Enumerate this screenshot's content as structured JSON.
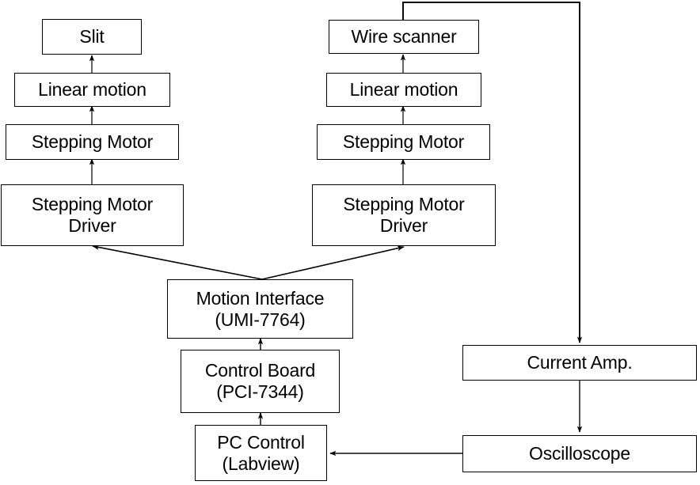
{
  "diagram": {
    "title": "Beam profile measurement control block diagram",
    "background_color": "#ffffff",
    "line_color": "#000000",
    "text_color": "#000000",
    "nodes": {
      "slit": {
        "label": "Slit"
      },
      "left_linear_motion": {
        "label": "Linear motion"
      },
      "left_stepping_motor": {
        "label": "Stepping Motor"
      },
      "left_stepping_motor_driver": {
        "label": "Stepping Motor\nDriver"
      },
      "wire_scanner": {
        "label": "Wire scanner"
      },
      "right_linear_motion": {
        "label": "Linear motion"
      },
      "right_stepping_motor": {
        "label": "Stepping Motor"
      },
      "right_stepping_motor_driver": {
        "label": "Stepping Motor\nDriver"
      },
      "motion_interface": {
        "label": "Motion Interface\n(UMI-7764)"
      },
      "control_board": {
        "label": "Control Board\n(PCI-7344)"
      },
      "pc_control": {
        "label": "PC Control\n(Labview)"
      },
      "current_amp": {
        "label": "Current Amp."
      },
      "oscilloscope": {
        "label": "Oscilloscope"
      }
    },
    "edges": [
      {
        "name": "left-driver-to-motor",
        "from": "left_stepping_motor_driver",
        "to": "left_stepping_motor",
        "style": "arrow-up"
      },
      {
        "name": "left-motor-to-linear",
        "from": "left_stepping_motor",
        "to": "left_linear_motion",
        "style": "arrow-up"
      },
      {
        "name": "left-linear-to-slit",
        "from": "left_linear_motion",
        "to": "slit",
        "style": "arrow-up"
      },
      {
        "name": "right-driver-to-motor",
        "from": "right_stepping_motor_driver",
        "to": "right_stepping_motor",
        "style": "arrow-up"
      },
      {
        "name": "right-motor-to-linear",
        "from": "right_stepping_motor",
        "to": "right_linear_motion",
        "style": "arrow-up"
      },
      {
        "name": "right-linear-to-wire-scanner",
        "from": "right_linear_motion",
        "to": "wire_scanner",
        "style": "arrow-up"
      },
      {
        "name": "motion-interface-to-left-driver",
        "from": "motion_interface",
        "to": "left_stepping_motor_driver",
        "style": "arrow-diagonal-up-left"
      },
      {
        "name": "motion-interface-to-right-driver",
        "from": "motion_interface",
        "to": "right_stepping_motor_driver",
        "style": "arrow-diagonal-up-right"
      },
      {
        "name": "control-board-to-motion-interface",
        "from": "control_board",
        "to": "motion_interface",
        "style": "arrow-up"
      },
      {
        "name": "pc-control-to-control-board",
        "from": "pc_control",
        "to": "control_board",
        "style": "arrow-up"
      },
      {
        "name": "wire-scanner-to-current-amp",
        "from": "wire_scanner",
        "to": "current_amp",
        "style": "routed-arrow-down"
      },
      {
        "name": "current-amp-to-oscilloscope",
        "from": "current_amp",
        "to": "oscilloscope",
        "style": "arrow-down"
      },
      {
        "name": "oscilloscope-to-pc-control",
        "from": "oscilloscope",
        "to": "pc_control",
        "style": "arrow-left"
      }
    ]
  }
}
